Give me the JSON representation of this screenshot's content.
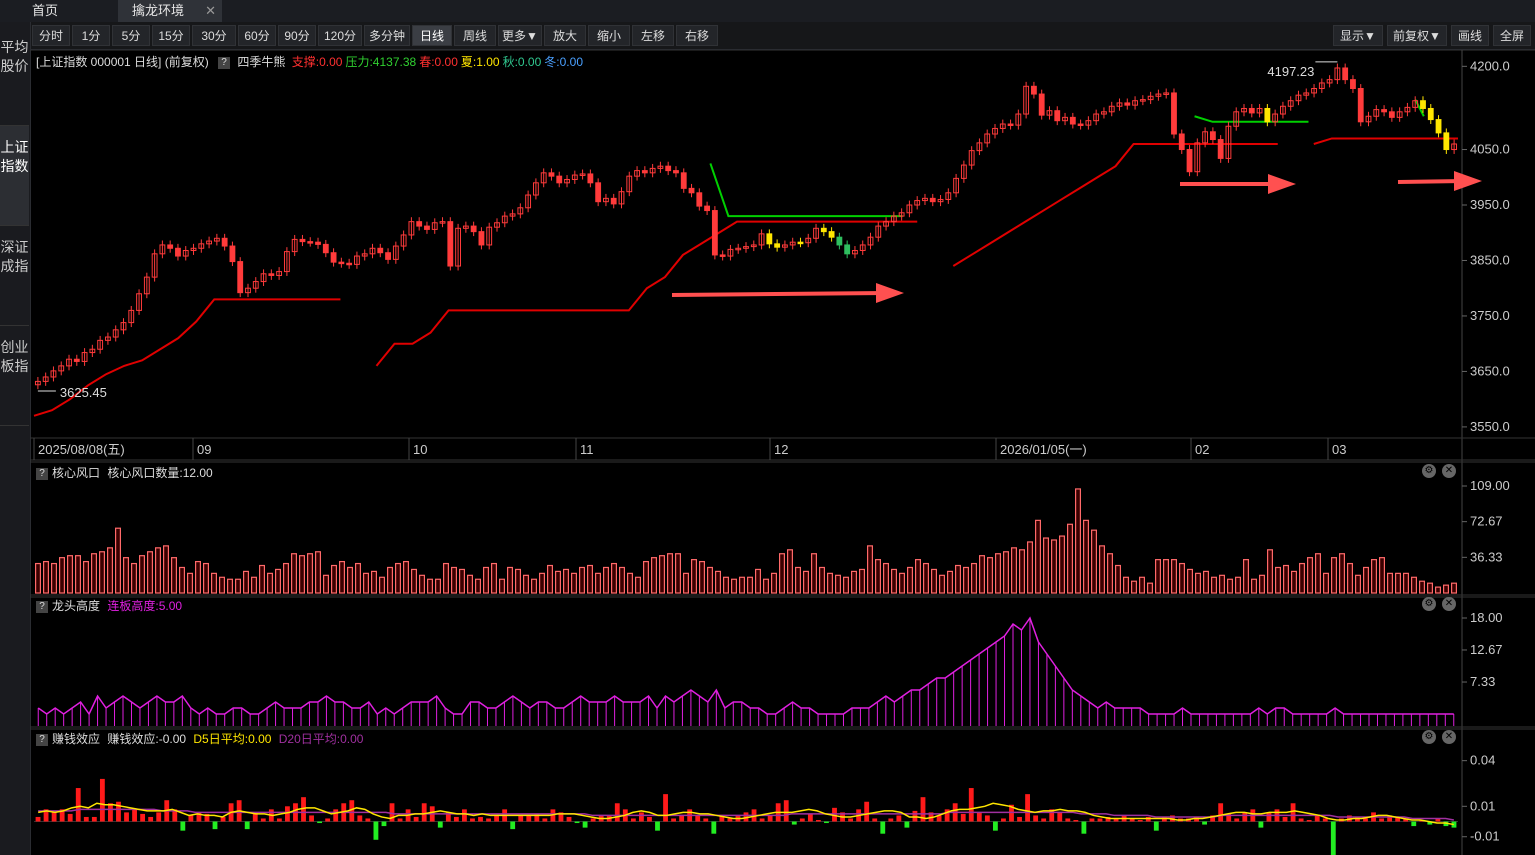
{
  "tabs": [
    {
      "label": "首页"
    },
    {
      "label": "擒龙环境"
    }
  ],
  "toolbar": {
    "left": [
      "分时",
      "1分",
      "5分",
      "15分",
      "30分",
      "60分",
      "90分",
      "120分",
      "多分钟",
      "日线",
      "周线",
      "更多▼",
      "放大",
      "缩小",
      "左移",
      "右移"
    ],
    "active": "日线",
    "right": [
      "显示▼",
      "前复权▼",
      "画线",
      "全屏"
    ]
  },
  "sidebar": [
    "平均股价",
    "上证指数",
    "深证成指",
    "创业板指"
  ],
  "sidebar_active": "上证指数",
  "colors": {
    "up": "#ff3b3b",
    "down_yellow": "#ffe600",
    "down_green": "#2fbf5f",
    "support": "#e00000",
    "resistance": "#00d000",
    "magenta": "#e020e0",
    "arrow": "#ff5050",
    "grid": "#2a2a2a"
  },
  "chart_data": [
    {
      "type": "candlestick",
      "title": "[上证指数 000001 日线] (前复权)",
      "indicator": {
        "name": "四季牛熊",
        "values": [
          {
            "label": "支撑:0.00",
            "color": "#ff3030"
          },
          {
            "label": "压力:4137.38",
            "color": "#30d030"
          },
          {
            "label": "春:0.00",
            "color": "#ff3030"
          },
          {
            "label": "夏:1.00",
            "color": "#ffe600"
          },
          {
            "label": "秋:0.00",
            "color": "#30c890"
          },
          {
            "label": "冬:0.00",
            "color": "#4aa0ff"
          }
        ]
      },
      "y_ticks": [
        "4200.0",
        "4050.0",
        "3950.0",
        "3850.0",
        "3750.0",
        "3650.0",
        "3550.0"
      ],
      "ylim": [
        3530,
        4215
      ],
      "x_labels": [
        "2025/08/08(五)",
        "09",
        "10",
        "11",
        "12",
        "2026/01/05(一)",
        "02",
        "03"
      ],
      "high_label": "4197.23",
      "low_label": "3625.45",
      "series_close": [
        3632,
        3640,
        3651,
        3660,
        3672,
        3668,
        3684,
        3690,
        3706,
        3712,
        3725,
        3738,
        3760,
        3790,
        3820,
        3862,
        3878,
        3872,
        3858,
        3868,
        3872,
        3880,
        3885,
        3890,
        3876,
        3848,
        3792,
        3800,
        3812,
        3826,
        3823,
        3830,
        3866,
        3888,
        3884,
        3883,
        3879,
        3864,
        3847,
        3845,
        3843,
        3858,
        3862,
        3872,
        3864,
        3852,
        3876,
        3896,
        3920,
        3912,
        3906,
        3918,
        3920,
        3840,
        3908,
        3912,
        3902,
        3878,
        3910,
        3918,
        3930,
        3934,
        3945,
        3968,
        3990,
        4008,
        4002,
        3990,
        3996,
        4004,
        4006,
        3990,
        3956,
        3962,
        3952,
        3974,
        4002,
        4012,
        4008,
        4016,
        4020,
        4012,
        4008,
        3980,
        3972,
        3948,
        3940,
        3860,
        3858,
        3870,
        3872,
        3875,
        3878,
        3898,
        3880,
        3874,
        3878,
        3883,
        3882,
        3890,
        3908,
        3902,
        3892,
        3878,
        3862,
        3868,
        3878,
        3892,
        3912,
        3920,
        3930,
        3936,
        3950,
        3958,
        3962,
        3956,
        3960,
        3972,
        3998,
        4022,
        4048,
        4062,
        4078,
        4088,
        4096,
        4094,
        4114,
        4164,
        4150,
        4112,
        4120,
        4102,
        4108,
        4096,
        4094,
        4102,
        4114,
        4118,
        4128,
        4134,
        4130,
        4138,
        4140,
        4146,
        4150,
        4152,
        4078,
        4050,
        4010,
        4062,
        4082,
        4068,
        4034,
        4092,
        4118,
        4124,
        4116,
        4124,
        4100,
        4114,
        4128,
        4138,
        4148,
        4152,
        4160,
        4170,
        4176,
        4197,
        4176,
        4160,
        4100,
        4110,
        4122,
        4118,
        4108,
        4118,
        4126,
        4138,
        4124,
        4104,
        4080,
        4050,
        4060
      ],
      "support_line": [
        3570,
        3580,
        3600,
        3625,
        3645,
        3660,
        3670,
        3690,
        3710,
        3740,
        3780,
        3780,
        3780,
        3780,
        3780,
        3780,
        3780,
        3780,
        null,
        3660,
        3700,
        3700,
        3720,
        3760,
        3760,
        3760,
        3760,
        3760,
        3760,
        3760,
        3760,
        3760,
        3760,
        3760,
        3800,
        3820,
        3860,
        3880,
        3900,
        3920,
        3920,
        3920,
        3920,
        3920,
        3920,
        3920,
        3920,
        3920,
        3920,
        3920,
        null,
        3840,
        3860,
        3880,
        3900,
        3920,
        3940,
        3960,
        3980,
        4000,
        4020,
        4060,
        4060,
        4060,
        4060,
        4060,
        4060,
        4060,
        4060,
        4060,
        null,
        4060,
        4070,
        4070,
        4070,
        4070,
        4070,
        4070,
        4070,
        4070
      ],
      "resistance_segments": [
        {
          "from": 0.475,
          "to": 0.61,
          "start": 4025,
          "value": 3930
        },
        {
          "from": 0.815,
          "to": 0.895,
          "start": 4110,
          "value": 4100
        },
        {
          "from": 0.97,
          "to": 0.976,
          "start": 4140,
          "value": 4110
        }
      ]
    },
    {
      "type": "bar",
      "title": "核心风口",
      "label": "核心风口数量:12.00",
      "y_ticks": [
        "109.00",
        "72.67",
        "36.33"
      ],
      "ylim": [
        0,
        109
      ],
      "values": [
        30,
        32,
        30,
        36,
        38,
        38,
        32,
        40,
        42,
        46,
        66,
        36,
        30,
        38,
        42,
        46,
        48,
        36,
        26,
        20,
        32,
        30,
        20,
        16,
        14,
        14,
        22,
        16,
        28,
        20,
        24,
        30,
        40,
        38,
        40,
        42,
        18,
        28,
        32,
        26,
        30,
        20,
        22,
        16,
        26,
        30,
        32,
        24,
        18,
        14,
        14,
        30,
        26,
        24,
        18,
        14,
        26,
        30,
        14,
        26,
        24,
        18,
        14,
        20,
        28,
        22,
        24,
        20,
        26,
        28,
        20,
        26,
        30,
        26,
        20,
        16,
        32,
        36,
        38,
        40,
        40,
        20,
        34,
        32,
        26,
        22,
        16,
        14,
        16,
        16,
        24,
        14,
        20,
        40,
        44,
        26,
        22,
        40,
        26,
        20,
        18,
        16,
        22,
        24,
        48,
        34,
        30,
        24,
        20,
        26,
        34,
        30,
        24,
        18,
        22,
        28,
        26,
        30,
        38,
        36,
        40,
        42,
        46,
        44,
        52,
        74,
        56,
        54,
        58,
        70,
        106,
        74,
        64,
        48,
        40,
        28,
        16,
        12,
        16,
        10,
        34,
        34,
        34,
        30,
        24,
        20,
        22,
        16,
        18,
        14,
        16,
        34,
        14,
        18,
        44,
        26,
        28,
        22,
        30,
        36,
        40,
        20,
        36,
        40,
        30,
        18,
        26,
        34,
        36,
        20,
        20,
        20,
        16,
        12,
        10,
        6,
        8,
        10
      ],
      "color": "#ff6a6a"
    },
    {
      "type": "line",
      "title": "龙头高度",
      "label": "连板高度:5.00",
      "y_ticks": [
        "18.00",
        "12.67",
        "7.33"
      ],
      "ylim": [
        0,
        18
      ],
      "values": [
        3,
        2,
        3,
        2,
        3,
        4,
        2,
        5,
        3,
        4,
        5,
        4,
        3,
        4,
        5,
        4,
        4,
        5,
        3,
        2,
        3,
        2,
        2,
        3,
        3,
        2,
        2,
        3,
        4,
        3,
        3,
        3,
        4,
        4,
        5,
        4,
        4,
        3,
        3,
        4,
        2,
        3,
        2,
        3,
        4,
        4,
        4,
        5,
        3,
        2,
        2,
        4,
        4,
        3,
        3,
        4,
        5,
        4,
        3,
        4,
        4,
        3,
        3,
        4,
        5,
        4,
        4,
        4,
        5,
        4,
        4,
        4,
        5,
        3,
        5,
        4,
        5,
        6,
        5,
        4,
        6,
        3,
        4,
        4,
        3,
        3,
        2,
        2,
        3,
        4,
        3,
        3,
        2,
        2,
        2,
        2,
        3,
        3,
        3,
        4,
        5,
        4,
        5,
        6,
        6,
        7,
        8,
        8,
        9,
        10,
        11,
        12,
        13,
        14,
        15,
        17,
        16,
        18,
        14,
        12,
        10,
        8,
        6,
        5,
        4,
        3,
        4,
        3,
        3,
        3,
        3,
        2,
        2,
        2,
        2,
        3,
        2,
        2,
        2,
        2,
        2,
        2,
        2,
        2,
        3,
        2,
        3,
        3,
        2,
        2,
        2,
        2,
        2,
        3,
        2,
        2,
        2,
        2,
        2,
        2,
        2,
        2,
        2,
        2,
        2,
        2,
        2,
        2
      ],
      "color": "#e020e0"
    },
    {
      "type": "bar",
      "title": "赚钱效应",
      "label": "赚钱效应:-0.00",
      "legend": [
        {
          "label": "D5日平均:0.00",
          "color": "#ffe600"
        },
        {
          "label": "D20日平均:0.00",
          "color": "#a030a0"
        }
      ],
      "y_ticks": [
        "0.04",
        "0.01",
        "-0.01"
      ],
      "ylim": [
        -0.022,
        0.047
      ],
      "values": [
        0.003,
        0.008,
        0.006,
        0.008,
        0.005,
        0.022,
        0.003,
        0.003,
        0.028,
        0.012,
        0.013,
        0.006,
        0.008,
        0.005,
        0.003,
        0.006,
        0.014,
        0.008,
        -0.006,
        0.004,
        0.006,
        0.005,
        -0.005,
        0.003,
        0.012,
        0.014,
        -0.005,
        0.006,
        0.002,
        0.008,
        0.002,
        0.01,
        0.012,
        0.016,
        0.004,
        -0.001,
        0.002,
        0.008,
        0.012,
        0.014,
        0.004,
        0.002,
        -0.012,
        -0.003,
        0.012,
        0.002,
        0.008,
        0.003,
        0.012,
        0.01,
        -0.004,
        0.006,
        0.003,
        0.008,
        0.002,
        0.003,
        0.002,
        0.004,
        0.008,
        -0.005,
        0.004,
        0.004,
        0.005,
        0.002,
        0.008,
        0.006,
        0.003,
        -0.001,
        -0.004,
        0.002,
        0.004,
        0.004,
        0.012,
        0.008,
        0.002,
        0.006,
        0.003,
        -0.006,
        0.018,
        0.002,
        0.004,
        0.008,
        0.004,
        0.002,
        -0.008,
        0.004,
        0.002,
        0.004,
        0.006,
        0.008,
        0.002,
        0.004,
        0.012,
        0.014,
        -0.002,
        0.002,
        0.005,
        0.001,
        -0.001,
        0.009,
        0.006,
        0.002,
        0.008,
        0.013,
        0.002,
        -0.008,
        0.002,
        0.004,
        -0.004,
        0.007,
        0.016,
        0.006,
        0.004,
        0.008,
        0.012,
        0.005,
        0.022,
        0.006,
        0.004,
        -0.006,
        0.002,
        0.011,
        0.003,
        0.018,
        0.004,
        0.002,
        0.008,
        0.006,
        0.002,
        0.001,
        -0.008,
        0.002,
        0.002,
        0.003,
        0.002,
        0.004,
        0.002,
        0.001,
        0.003,
        -0.006,
        0.003,
        0.004,
        0.002,
        0.002,
        0.003,
        -0.002,
        0.004,
        0.012,
        0.005,
        0.002,
        0.006,
        0.008,
        -0.004,
        0.006,
        0.008,
        0.003,
        0.012,
        0.002,
        0.001,
        0.004,
        0.002,
        -0.024,
        0.002,
        0.004,
        0.003,
        0.002,
        0.006,
        0.002,
        0.004,
        0.003,
        0.002,
        -0.003,
        0.001,
        -0.002,
        0.002,
        -0.003,
        -0.004
      ],
      "avg5": [
        0.006,
        0.007,
        0.006,
        0.007,
        0.009,
        0.01,
        0.009,
        0.012,
        0.011,
        0.011,
        0.01,
        0.009,
        0.008,
        0.007,
        0.007,
        0.007,
        0.008,
        0.006,
        0.004,
        0.005,
        0.004,
        0.004,
        0.003,
        0.006,
        0.007,
        0.006,
        0.005,
        0.005,
        0.004,
        0.005,
        0.006,
        0.008,
        0.009,
        0.009,
        0.007,
        0.005,
        0.006,
        0.007,
        0.009,
        0.008,
        0.005,
        0.003,
        0.002,
        0.004,
        0.004,
        0.005,
        0.005,
        0.006,
        0.007,
        0.006,
        0.005,
        0.005,
        0.004,
        0.005,
        0.004,
        0.004,
        0.004,
        0.004,
        0.004,
        0.004,
        0.004,
        0.004,
        0.005,
        0.005,
        0.005,
        0.004,
        0.003,
        0.002,
        0.002,
        0.003,
        0.004,
        0.006,
        0.007,
        0.006,
        0.004,
        0.004,
        0.005,
        0.006,
        0.006,
        0.005,
        0.005,
        0.004,
        0.003,
        0.002,
        0.002,
        0.003,
        0.004,
        0.005,
        0.006,
        0.006,
        0.006,
        0.007,
        0.008,
        0.007,
        0.005,
        0.004,
        0.003,
        0.003,
        0.004,
        0.005,
        0.006,
        0.007,
        0.007,
        0.006,
        0.003,
        0.003,
        0.002,
        0.003,
        0.005,
        0.007,
        0.008,
        0.008,
        0.009,
        0.01,
        0.012,
        0.011,
        0.01,
        0.008,
        0.007,
        0.006,
        0.007,
        0.007,
        0.008,
        0.007,
        0.007,
        0.006,
        0.004,
        0.003,
        0.002,
        0.002,
        0.002,
        0.002,
        0.002,
        0.002,
        0.002,
        0.002,
        0.001,
        0.001,
        0.002,
        0.002,
        0.003,
        0.004,
        0.005,
        0.006,
        0.006,
        0.005,
        0.005,
        0.006,
        0.006,
        0.006,
        0.007,
        0.006,
        0.005,
        0.004,
        0.002,
        0.001,
        0.001,
        0.002,
        0.002,
        0.003,
        0.004,
        0.004,
        0.003,
        0.002,
        0.001,
        0.001,
        0.0,
        -0.001,
        -0.001,
        -0.002
      ],
      "avg20": [
        0.007,
        0.007,
        0.007,
        0.007,
        0.007,
        0.008,
        0.008,
        0.008,
        0.008,
        0.008,
        0.008,
        0.008,
        0.008,
        0.008,
        0.008,
        0.007,
        0.007,
        0.007,
        0.007,
        0.006,
        0.006,
        0.006,
        0.006,
        0.006,
        0.006,
        0.006,
        0.006,
        0.006,
        0.006,
        0.006,
        0.006,
        0.006,
        0.006,
        0.006,
        0.006,
        0.006,
        0.006,
        0.006,
        0.006,
        0.006,
        0.006,
        0.006,
        0.006,
        0.005,
        0.005,
        0.005,
        0.005,
        0.005,
        0.005,
        0.005,
        0.005,
        0.005,
        0.005,
        0.005,
        0.005,
        0.005,
        0.005,
        0.005,
        0.005,
        0.005,
        0.005,
        0.005,
        0.005,
        0.005,
        0.005,
        0.005,
        0.005,
        0.004,
        0.004,
        0.004,
        0.004,
        0.004,
        0.004,
        0.004,
        0.004,
        0.004,
        0.004,
        0.004,
        0.004,
        0.004,
        0.004,
        0.004,
        0.004,
        0.004,
        0.004,
        0.004,
        0.004,
        0.004,
        0.004,
        0.004,
        0.004,
        0.005,
        0.005,
        0.005,
        0.005,
        0.005,
        0.005,
        0.005,
        0.005,
        0.005,
        0.005,
        0.005,
        0.005,
        0.005,
        0.005,
        0.005,
        0.005,
        0.005,
        0.005,
        0.005,
        0.006,
        0.006,
        0.006,
        0.006,
        0.006,
        0.006,
        0.006,
        0.006,
        0.006,
        0.006,
        0.006,
        0.006,
        0.006,
        0.006,
        0.006,
        0.006,
        0.005,
        0.005,
        0.005,
        0.005,
        0.004,
        0.004,
        0.004,
        0.004,
        0.004,
        0.003,
        0.003,
        0.003,
        0.003,
        0.003,
        0.003,
        0.003,
        0.003,
        0.004,
        0.004,
        0.004,
        0.004,
        0.004,
        0.004,
        0.004,
        0.004,
        0.004,
        0.004,
        0.004,
        0.004,
        0.004,
        0.004,
        0.003,
        0.003,
        0.003,
        0.003,
        0.003,
        0.003,
        0.003,
        0.003,
        0.003,
        0.002,
        0.002,
        0.002,
        0.002,
        0.002,
        0.001
      ]
    }
  ]
}
